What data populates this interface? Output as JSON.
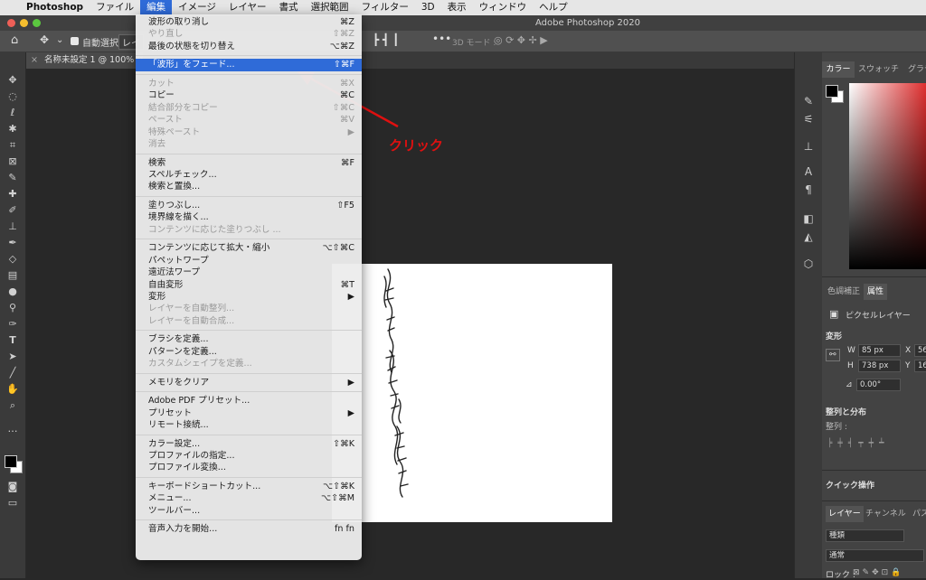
{
  "mac_menu": {
    "app": "Photoshop",
    "items": [
      "ファイル",
      "編集",
      "イメージ",
      "レイヤー",
      "書式",
      "選択範囲",
      "フィルター",
      "3D",
      "表示",
      "ウィンドウ",
      "ヘルプ"
    ],
    "active_index": 1
  },
  "window_title": "Adobe Photoshop 2020",
  "options_bar": {
    "auto_select_label": "自動選択 :",
    "auto_select_value": "レイ",
    "mode_3d_label": "3D モード :"
  },
  "document_tab": {
    "title": "名称未設定 1 @ 100% (波",
    "close": "×"
  },
  "edit_menu": [
    {
      "label": "波形の取り消し",
      "shortcut": "⌘Z",
      "disabled": false
    },
    {
      "label": "やり直し",
      "shortcut": "⇧⌘Z",
      "disabled": true
    },
    {
      "label": "最後の状態を切り替え",
      "shortcut": "⌥⌘Z",
      "disabled": false
    },
    {
      "sep": true
    },
    {
      "label": "「波形」をフェード...",
      "shortcut": "⇧⌘F",
      "disabled": false,
      "highlight": true
    },
    {
      "sep": true
    },
    {
      "label": "カット",
      "shortcut": "⌘X",
      "disabled": true
    },
    {
      "label": "コピー",
      "shortcut": "⌘C",
      "disabled": false
    },
    {
      "label": "結合部分をコピー",
      "shortcut": "⇧⌘C",
      "disabled": true
    },
    {
      "label": "ペースト",
      "shortcut": "⌘V",
      "disabled": true
    },
    {
      "label": "特殊ペースト",
      "shortcut": "▶",
      "disabled": true
    },
    {
      "label": "消去",
      "shortcut": "",
      "disabled": true
    },
    {
      "sep": true
    },
    {
      "label": "検索",
      "shortcut": "⌘F",
      "disabled": false
    },
    {
      "label": "スペルチェック...",
      "shortcut": "",
      "disabled": false
    },
    {
      "label": "検索と置換...",
      "shortcut": "",
      "disabled": false
    },
    {
      "sep": true
    },
    {
      "label": "塗りつぶし...",
      "shortcut": "⇧F5",
      "disabled": false
    },
    {
      "label": "境界線を描く...",
      "shortcut": "",
      "disabled": false
    },
    {
      "label": "コンテンツに応じた塗りつぶし ...",
      "shortcut": "",
      "disabled": true
    },
    {
      "sep": true
    },
    {
      "label": "コンテンツに応じて拡大・縮小",
      "shortcut": "⌥⇧⌘C",
      "disabled": false
    },
    {
      "label": "パペットワープ",
      "shortcut": "",
      "disabled": false
    },
    {
      "label": "遠近法ワープ",
      "shortcut": "",
      "disabled": false
    },
    {
      "label": "自由変形",
      "shortcut": "⌘T",
      "disabled": false
    },
    {
      "label": "変形",
      "shortcut": "▶",
      "disabled": false
    },
    {
      "label": "レイヤーを自動整列...",
      "shortcut": "",
      "disabled": true
    },
    {
      "label": "レイヤーを自動合成...",
      "shortcut": "",
      "disabled": true
    },
    {
      "sep": true
    },
    {
      "label": "ブラシを定義...",
      "shortcut": "",
      "disabled": false
    },
    {
      "label": "パターンを定義...",
      "shortcut": "",
      "disabled": false
    },
    {
      "label": "カスタムシェイプを定義...",
      "shortcut": "",
      "disabled": true
    },
    {
      "sep": true
    },
    {
      "label": "メモリをクリア",
      "shortcut": "▶",
      "disabled": false
    },
    {
      "sep": true
    },
    {
      "label": "Adobe PDF プリセット...",
      "shortcut": "",
      "disabled": false
    },
    {
      "label": "プリセット",
      "shortcut": "▶",
      "disabled": false
    },
    {
      "label": "リモート接続...",
      "shortcut": "",
      "disabled": false
    },
    {
      "sep": true
    },
    {
      "label": "カラー設定...",
      "shortcut": "⇧⌘K",
      "disabled": false
    },
    {
      "label": "プロファイルの指定...",
      "shortcut": "",
      "disabled": false
    },
    {
      "label": "プロファイル変換...",
      "shortcut": "",
      "disabled": false
    },
    {
      "sep": true
    },
    {
      "label": "キーボードショートカット...",
      "shortcut": "⌥⇧⌘K",
      "disabled": false
    },
    {
      "label": "メニュー...",
      "shortcut": "⌥⇧⌘M",
      "disabled": false
    },
    {
      "label": "ツールバー...",
      "shortcut": "",
      "disabled": false
    },
    {
      "sep": true
    },
    {
      "label": "音声入力を開始...",
      "shortcut": "fn fn",
      "disabled": false
    }
  ],
  "annotation": {
    "text": "クリック",
    "color": "#e01010"
  },
  "right_panels": {
    "color_tabs": [
      "カラー",
      "スウォッチ",
      "グラデ"
    ],
    "adjust_tabs": [
      "色調補正",
      "属性"
    ],
    "pixel_layer_label": "ピクセルレイヤー",
    "transform_label": "変形",
    "w_label": "W",
    "w_value": "85 px",
    "x_label": "X",
    "x_value": "56",
    "h_label": "H",
    "h_value": "738 px",
    "y_label": "Y",
    "y_value": "16",
    "angle_value": "0.00°",
    "align_label": "整列と分布",
    "align_sub": "整列 :",
    "quick_actions": "クイック操作",
    "layer_tabs": [
      "レイヤー",
      "チャンネル",
      "パス"
    ],
    "layer_filter": "種類",
    "blend_mode": "通常",
    "lock_label": "ロック :"
  },
  "colors": {
    "menu_highlight": "#2f6bd8",
    "arrow": "#e01010"
  }
}
